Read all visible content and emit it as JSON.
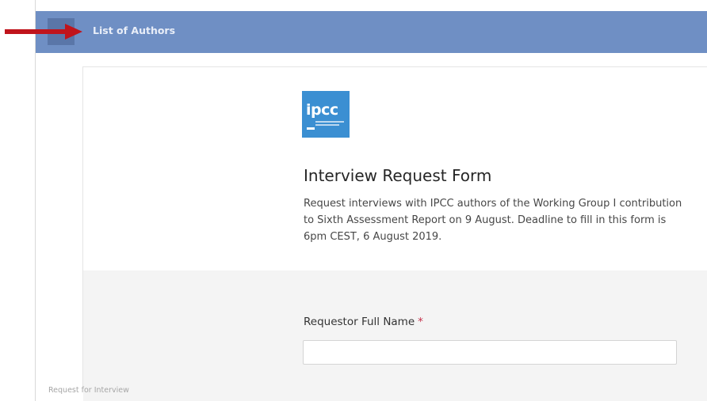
{
  "topbar": {
    "title": "List of Authors"
  },
  "logo": {
    "text": "ipcc"
  },
  "form": {
    "title": "Interview Request Form",
    "description": "Request interviews with IPCC authors of the Working Group I contribution to Sixth Assessment Report on 9 August. Deadline to fill in this form is 6pm CEST, 6 August 2019.",
    "fields": [
      {
        "label": "Requestor Full Name",
        "required_mark": "*",
        "value": ""
      }
    ]
  },
  "footer": {
    "text": "Request for Interview"
  },
  "colors": {
    "topbar": "#6f8fc4",
    "arrow": "#c0141c",
    "logo": "#3b8fd2",
    "required": "#c4314b"
  }
}
